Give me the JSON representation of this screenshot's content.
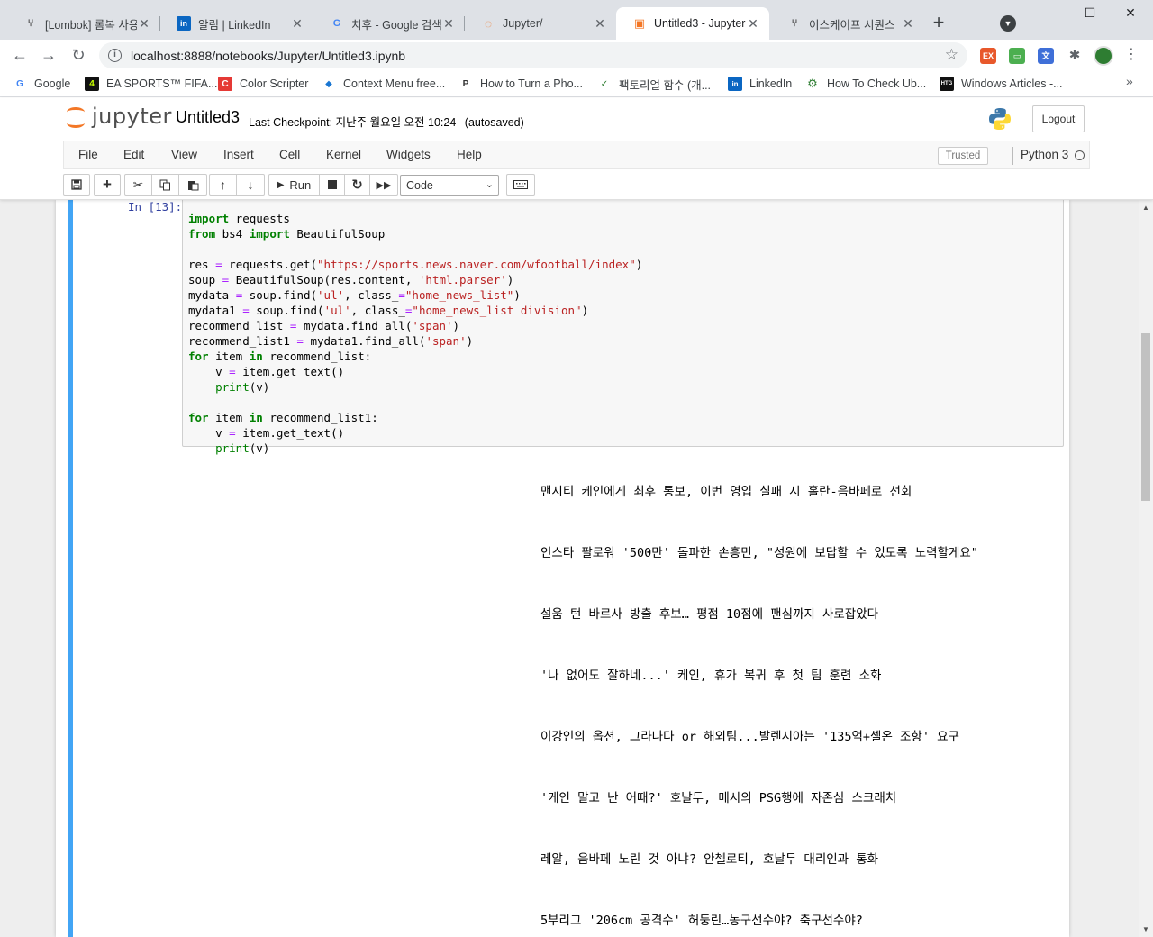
{
  "browser": {
    "tabs": [
      {
        "title": "[Lombok] 롬복 사용",
        "icon": "lombok-icon",
        "fav": "⑂",
        "active": false
      },
      {
        "title": "알림 | LinkedIn",
        "icon": "linkedin-icon",
        "fav": "in",
        "active": false
      },
      {
        "title": "치후 - Google 검색",
        "icon": "google-icon",
        "fav": "G",
        "active": false
      },
      {
        "title": "Jupyter/",
        "icon": "jupyter-icon",
        "fav": "◌",
        "active": false
      },
      {
        "title": "Untitled3 - Jupyter",
        "icon": "jupyter-notebook-icon",
        "fav": "▣",
        "active": true
      },
      {
        "title": "이스케이프 시퀀스",
        "icon": "escape-icon",
        "fav": "⑂",
        "active": false
      }
    ],
    "url": "localhost:8888/notebooks/Jupyter/Untitled3.ipynb",
    "bookmarks": [
      {
        "label": "Google",
        "icon": "google-icon",
        "fav": "G"
      },
      {
        "label": "EA SPORTS™ FIFA...",
        "icon": "ea-sports-icon",
        "fav": "4"
      },
      {
        "label": "Color Scripter",
        "icon": "color-scripter-icon",
        "fav": "C"
      },
      {
        "label": "Context Menu free...",
        "icon": "context-menu-icon",
        "fav": "◆"
      },
      {
        "label": "How to Turn a Pho...",
        "icon": "pinterest-icon",
        "fav": "P"
      },
      {
        "label": "팩토리얼 함수 (개...",
        "icon": "vue-icon",
        "fav": "✓"
      },
      {
        "label": "LinkedIn",
        "icon": "linkedin-icon",
        "fav": "in"
      },
      {
        "label": "How To Check Ub...",
        "icon": "ubuntu-gear-icon",
        "fav": "⚙"
      },
      {
        "label": "Windows Articles -...",
        "icon": "htg-icon",
        "fav": "HTG"
      }
    ]
  },
  "jupyter": {
    "logo_text": "jupyter",
    "notebook_name": "Untitled3",
    "checkpoint_label": "Last Checkpoint:",
    "checkpoint_time": "지난주 월요일 오전 10:24",
    "autosave": "(autosaved)",
    "logout": "Logout",
    "menu": [
      "File",
      "Edit",
      "View",
      "Insert",
      "Cell",
      "Kernel",
      "Widgets",
      "Help"
    ],
    "trusted": "Trusted",
    "kernel": "Python 3",
    "run_label": "Run",
    "cell_type": "Code"
  },
  "cell": {
    "prompt": "In [13]:",
    "code_lines": [
      "import requests",
      "from bs4 import BeautifulSoup",
      "",
      "res = requests.get(\"https://sports.news.naver.com/wfootball/index\")",
      "soup = BeautifulSoup(res.content, 'html.parser')",
      "mydata = soup.find('ul', class_=\"home_news_list\")",
      "mydata1 = soup.find('ul', class_=\"home_news_list division\")",
      "recommend_list = mydata.find_all('span')",
      "recommend_list1 = mydata1.find_all('span')",
      "for item in recommend_list:",
      "    v = item.get_text()",
      "    print(v)",
      "",
      "for item in recommend_list1:",
      "    v = item.get_text()",
      "    print(v)"
    ],
    "output_lines": [
      "맨시티 케인에게 최후 통보, 이번 영입 실패 시 홀란-음바페로 선회",
      "인스타 팔로워 '500만' 돌파한 손흥민, \"성원에 보답할 수 있도록 노력할게요\"",
      "설움 턴 바르사 방출 후보… 평점 10점에 팬심까지 사로잡았다",
      "'나 없어도 잘하네...' 케인, 휴가 복귀 후 첫 팀 훈련 소화",
      "이강인의 옵션, 그라나다 or 해외팀...발렌시아는 '135억+셀온 조항' 요구",
      "'케인 말고 난 어때?' 호날두, 메시의 PSG행에 자존심 스크래치",
      "레알, 음바페 노린 것 아냐? 안첼로티, 호날두 대리인과 통화",
      "5부리그  '206cm 공격수'  허둥린…농구선수야? 축구선수야?"
    ]
  },
  "colors": {
    "accent_orange": "#f37726",
    "cell_selected": "#42a5f5",
    "keyword": "#008000",
    "string": "#ba2121"
  }
}
